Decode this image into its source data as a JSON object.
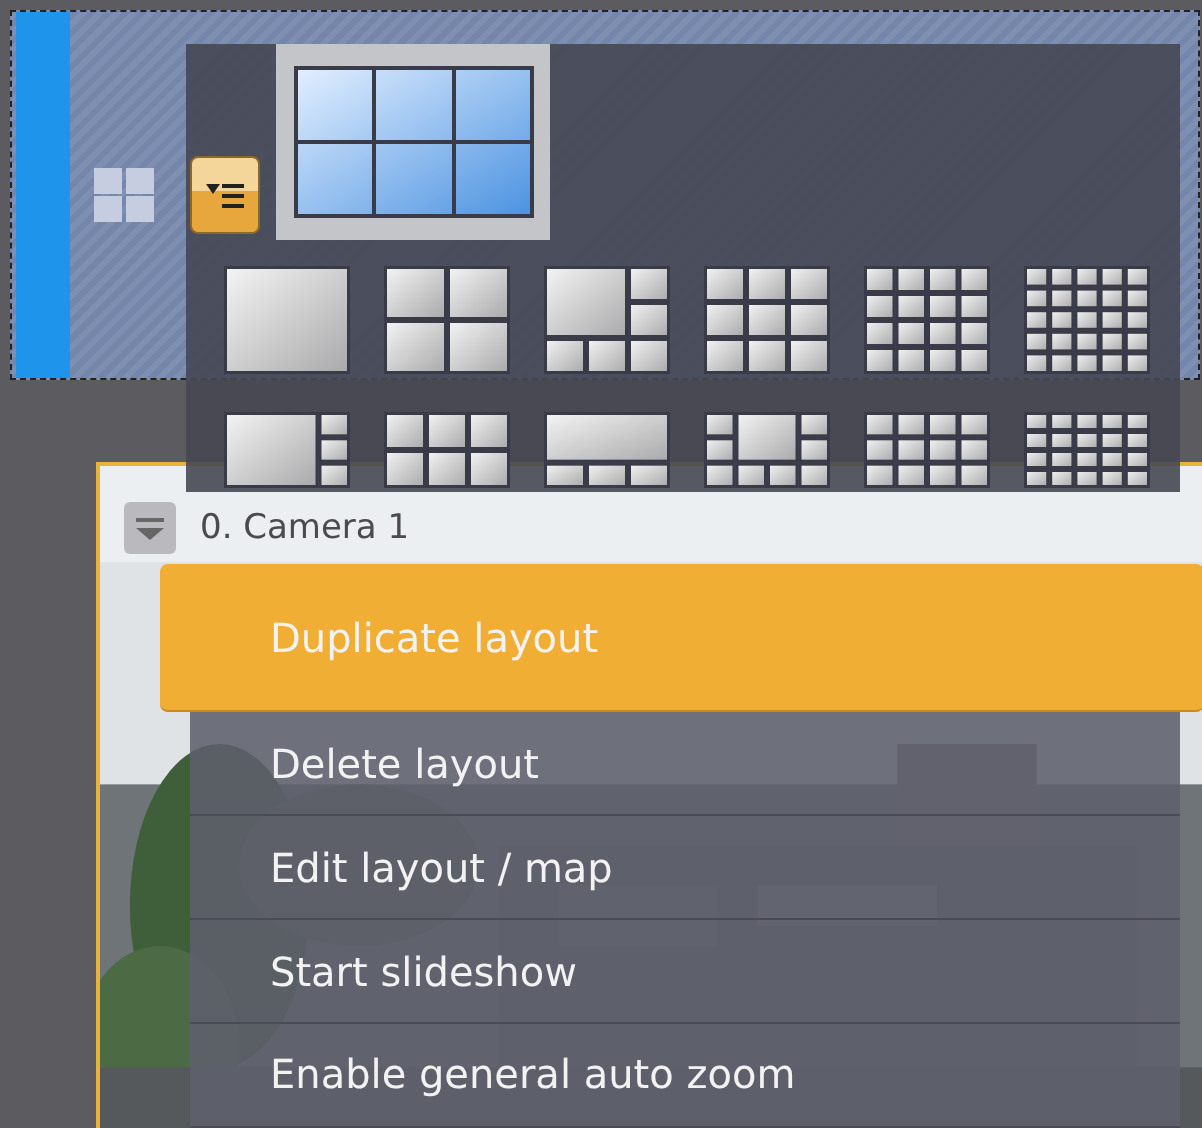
{
  "camera": {
    "title": "0. Camera 1"
  },
  "menu": {
    "items": [
      {
        "label": "Duplicate layout",
        "selected": true
      },
      {
        "label": "Delete layout",
        "selected": false
      },
      {
        "label": "Edit layout / map",
        "selected": false
      },
      {
        "label": "Start slideshow",
        "selected": false
      },
      {
        "label": "Enable general auto zoom",
        "selected": false
      }
    ]
  }
}
